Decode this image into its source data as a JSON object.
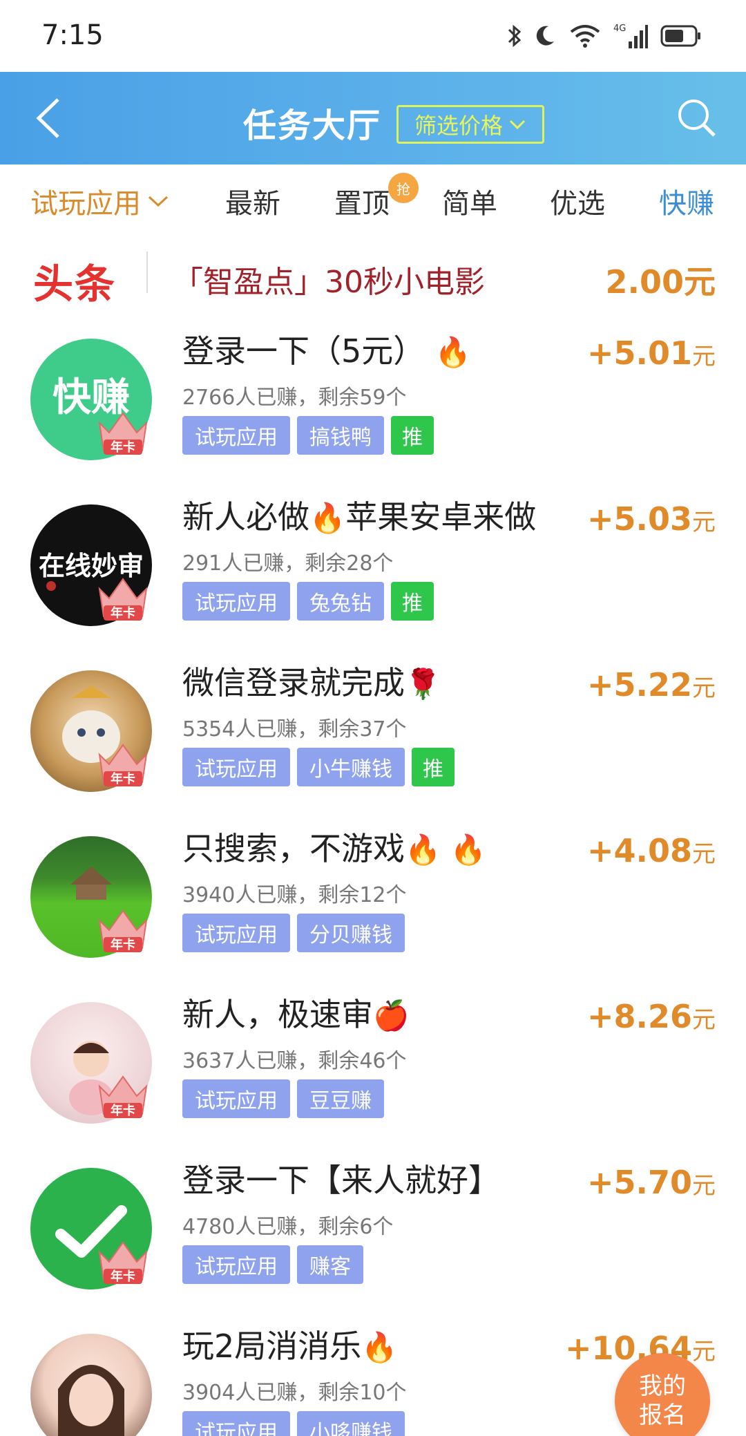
{
  "status_bar": {
    "time": "7:15",
    "network": "4G"
  },
  "header": {
    "title": "任务大厅",
    "filter_label": "筛选价格"
  },
  "tabs": {
    "category": "试玩应用",
    "items": [
      "最新",
      "置顶",
      "简单",
      "优选",
      "快赚"
    ],
    "badge": "抢"
  },
  "headline": {
    "logo": "头条",
    "text": "「智盈点」30秒小电影",
    "price": "2.00元"
  },
  "tasks": [
    {
      "title": "登录一下（5元）",
      "emoji": "🔥",
      "meta": "2766人已赚，剩余59个",
      "tags": [
        "试玩应用",
        "搞钱鸭"
      ],
      "rec": "推",
      "price": "+5.01",
      "unit": "元",
      "avatar_text": "快赚"
    },
    {
      "title": "新人必做",
      "emoji": "🔥",
      "title2": "苹果安卓来做",
      "meta": "291人已赚，剩余28个",
      "tags": [
        "试玩应用",
        "兔兔钻"
      ],
      "rec": "推",
      "price": "+5.03",
      "unit": "元",
      "avatar_text": "在线妙审"
    },
    {
      "title": "微信登录就完成",
      "emoji": "🌹",
      "meta": "5354人已赚，剩余37个",
      "tags": [
        "试玩应用",
        "小牛赚钱"
      ],
      "rec": "推",
      "price": "+5.22",
      "unit": "元"
    },
    {
      "title": "只搜索，不游戏",
      "emoji": "🔥 🔥",
      "meta": "3940人已赚，剩余12个",
      "tags": [
        "试玩应用",
        "分贝赚钱"
      ],
      "price": "+4.08",
      "unit": "元"
    },
    {
      "title": "新人，极速审",
      "emoji": "🍎",
      "meta": "3637人已赚，剩余46个",
      "tags": [
        "试玩应用",
        "豆豆赚"
      ],
      "price": "+8.26",
      "unit": "元"
    },
    {
      "title": "登录一下【来人就好】",
      "meta": "4780人已赚，剩余6个",
      "tags": [
        "试玩应用",
        "赚客"
      ],
      "price": "+5.70",
      "unit": "元"
    },
    {
      "title": "玩2局消消乐",
      "emoji": "🔥",
      "meta": "3904人已赚，剩余10个",
      "tags": [
        "试玩应用",
        "小哆赚钱"
      ],
      "price": "+10.64",
      "unit": "元"
    }
  ],
  "crown_label": "年卡",
  "floating": {
    "line1": "我的",
    "line2": "报名"
  },
  "colors": {
    "header_start": "#4aa0e6",
    "header_end": "#67bfe9",
    "price": "#e08a2a",
    "tag": "#8fa2ee",
    "rec": "#2fc74b",
    "headline_text": "#a0232b",
    "headline_logo": "#e3322f"
  }
}
